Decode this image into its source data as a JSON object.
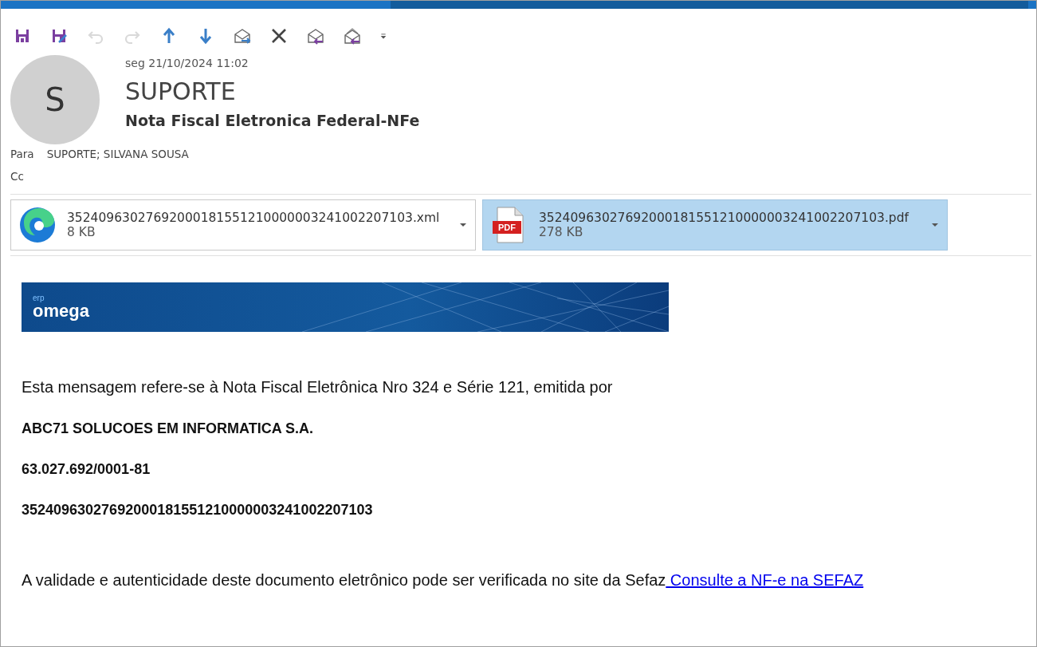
{
  "toolbar": {
    "buttons": [
      {
        "kind": "save"
      },
      {
        "kind": "save-edit"
      },
      {
        "kind": "undo",
        "disabled": true
      },
      {
        "kind": "redo",
        "disabled": true
      },
      {
        "kind": "up",
        "disabled": false
      },
      {
        "kind": "down",
        "disabled": false
      },
      {
        "kind": "forward-mail",
        "disabled": false
      },
      {
        "kind": "delete",
        "disabled": false
      },
      {
        "kind": "reply",
        "disabled": false
      },
      {
        "kind": "reply-all",
        "disabled": false
      },
      {
        "kind": "more",
        "disabled": false
      }
    ]
  },
  "header": {
    "avatar_initial": "S",
    "date": "seg 21/10/2024 11:02",
    "sender": "SUPORTE",
    "subject": "Nota Fiscal Eletronica Federal-NFe",
    "to_label": "Para",
    "to": "SUPORTE; SILVANA SOUSA",
    "cc_label": "Cc"
  },
  "attachments": [
    {
      "kind": "xml",
      "name": "35240963027692000181551210000003241002207103.xml",
      "size": "8 KB",
      "selected": false
    },
    {
      "kind": "pdf",
      "name": "35240963027692000181551210000003241002207103.pdf",
      "size": "278 KB",
      "selected": true,
      "icon_text": "PDF"
    }
  ],
  "body": {
    "banner": {
      "logo_small": "erp",
      "logo": "omega"
    },
    "intro": "Esta mensagem refere-se à Nota Fiscal Eletrônica Nro 324 e Série 121, emitida por",
    "company": "ABC71 SOLUCOES EM INFORMATICA S.A.",
    "cnpj": "63.027.692/0001-81",
    "access_key": "35240963027692000181551210000003241002207103",
    "footer": "A validade e autenticidade deste documento eletrônico pode ser verificada no site da Sefaz",
    "link": " Consulte a NF-e na SEFAZ"
  }
}
